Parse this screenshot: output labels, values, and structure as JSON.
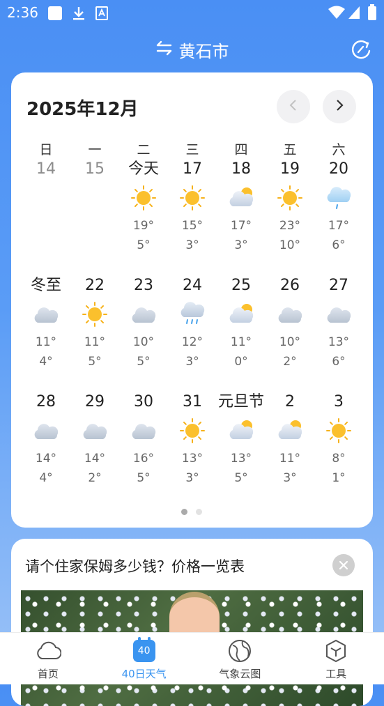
{
  "status_bar": {
    "time": "2:36",
    "icons": [
      "square-icon",
      "download-icon",
      "image-a-icon",
      "wifi-icon",
      "signal-icon",
      "battery-icon"
    ]
  },
  "header": {
    "city": "黄石市",
    "swap_icon": "swap-arrows-icon",
    "refresh_icon": "refresh-icon"
  },
  "calendar": {
    "month_title": "2025年12月",
    "weekdays": [
      "日",
      "一",
      "二",
      "三",
      "四",
      "五",
      "六"
    ],
    "rows": [
      [
        {
          "label": "14",
          "past": true,
          "weather": "",
          "high": "",
          "low": ""
        },
        {
          "label": "15",
          "past": true,
          "weather": "",
          "high": "",
          "low": ""
        },
        {
          "label": "今天",
          "weather": "sunny",
          "high": "19°",
          "low": "5°"
        },
        {
          "label": "17",
          "weather": "sunny",
          "high": "15°",
          "low": "3°"
        },
        {
          "label": "18",
          "weather": "partly-cloudy",
          "high": "17°",
          "low": "3°"
        },
        {
          "label": "19",
          "weather": "sunny",
          "high": "23°",
          "low": "10°"
        },
        {
          "label": "20",
          "weather": "drizzle",
          "high": "17°",
          "low": "6°"
        }
      ],
      [
        {
          "label": "冬至",
          "weather": "cloudy",
          "high": "11°",
          "low": "4°"
        },
        {
          "label": "22",
          "weather": "sunny",
          "high": "11°",
          "low": "5°"
        },
        {
          "label": "23",
          "weather": "cloudy",
          "high": "10°",
          "low": "5°"
        },
        {
          "label": "24",
          "weather": "rain",
          "high": "12°",
          "low": "3°"
        },
        {
          "label": "25",
          "weather": "partly-cloudy",
          "high": "11°",
          "low": "0°"
        },
        {
          "label": "26",
          "weather": "cloudy",
          "high": "10°",
          "low": "2°"
        },
        {
          "label": "27",
          "weather": "cloudy",
          "high": "13°",
          "low": "6°"
        }
      ],
      [
        {
          "label": "28",
          "weather": "cloudy",
          "high": "14°",
          "low": "4°"
        },
        {
          "label": "29",
          "weather": "cloudy",
          "high": "14°",
          "low": "2°"
        },
        {
          "label": "30",
          "weather": "cloudy",
          "high": "16°",
          "low": "5°"
        },
        {
          "label": "31",
          "weather": "sunny",
          "high": "13°",
          "low": "3°"
        },
        {
          "label": "元旦节",
          "weather": "partly-cloudy",
          "high": "13°",
          "low": "5°"
        },
        {
          "label": "2",
          "weather": "partly-cloudy",
          "high": "11°",
          "low": "3°"
        },
        {
          "label": "3",
          "weather": "sunny",
          "high": "8°",
          "low": "1°"
        }
      ]
    ],
    "page_dots": 2,
    "active_dot": 0
  },
  "ad": {
    "title": "请个住家保姆多少钱？价格一览表",
    "close_icon": "close-icon"
  },
  "bottom_nav": [
    {
      "label": "首页",
      "icon": "cloud-icon",
      "active": false
    },
    {
      "label": "40日天气",
      "icon": "calendar-40-icon",
      "badge": "40",
      "active": true
    },
    {
      "label": "气象云图",
      "icon": "globe-icon",
      "active": false
    },
    {
      "label": "工具",
      "icon": "toolbox-icon",
      "active": false
    }
  ],
  "colors": {
    "accent": "#3a94f0",
    "header_bg": "#4a8ff4",
    "sun": "#fbc02d",
    "cloud": "#c9d3df"
  }
}
